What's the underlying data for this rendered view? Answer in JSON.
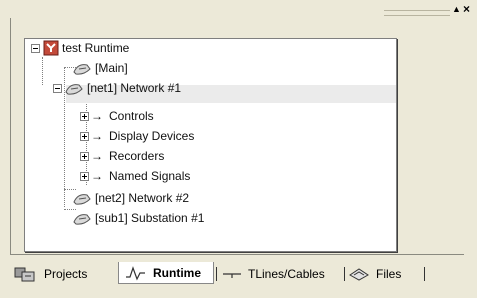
{
  "window": {
    "pin_icon": "▲",
    "close_icon": "×"
  },
  "tree": {
    "root": {
      "label": "test Runtime",
      "icon": "runtime-root-icon"
    },
    "items": [
      {
        "label": "[Main]",
        "icon": "network-icon"
      },
      {
        "label": "[net1] Network #1",
        "icon": "network-icon",
        "expanded": true,
        "selected": true
      },
      {
        "label": "Controls",
        "icon": "arrow-icon"
      },
      {
        "label": "Display Devices",
        "icon": "arrow-icon"
      },
      {
        "label": "Recorders",
        "icon": "arrow-icon"
      },
      {
        "label": "Named Signals",
        "icon": "arrow-icon"
      },
      {
        "label": "[net2] Network #2",
        "icon": "network-icon"
      },
      {
        "label": "[sub1] Substation #1",
        "icon": "network-icon"
      }
    ]
  },
  "tabs": [
    {
      "label": "Projects",
      "icon": "projects-icon",
      "active": false
    },
    {
      "label": "Runtime",
      "icon": "runtime-wave-icon",
      "active": true
    },
    {
      "label": "TLines/Cables",
      "icon": "tline-icon",
      "active": false
    },
    {
      "label": "Files",
      "icon": "files-icon",
      "active": false
    }
  ]
}
